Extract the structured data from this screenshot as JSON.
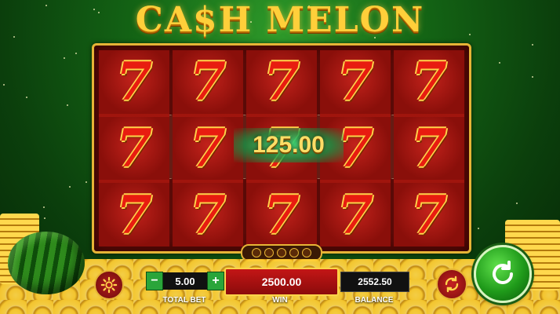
{
  "game": {
    "title": "CA$H MELON"
  },
  "reels": {
    "symbol": "7",
    "rows": 3,
    "columns": 5,
    "win_display": "125.00"
  },
  "controls": {
    "total_bet_value": "5.00",
    "total_bet_label": "TOTAL BET",
    "minus_label": "−",
    "plus_label": "+",
    "win_value": "2500.00",
    "win_label": "WIN",
    "balance_value": "2552.50",
    "balance_label": "BALANCE"
  },
  "icons": {
    "settings": "gear-icon",
    "autoplay": "autoplay-icon",
    "spin": "spin-icon"
  },
  "colors": {
    "frame_gold": "#e6b436",
    "reel_red": "#b3180f",
    "spin_green": "#1f9a1a"
  }
}
